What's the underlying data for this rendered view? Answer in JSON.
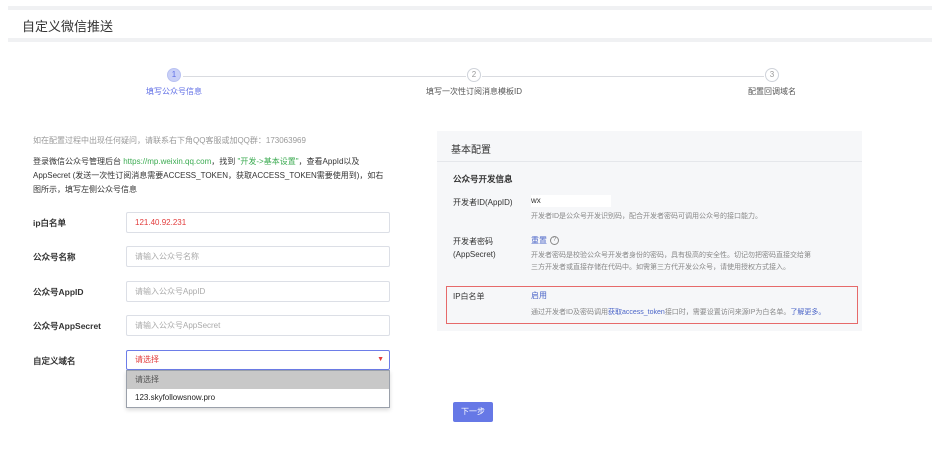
{
  "page": {
    "title": "自定义微信推送"
  },
  "steps": [
    {
      "num": "1",
      "label": "填写公众号信息",
      "active": true
    },
    {
      "num": "2",
      "label": "填写一次性订阅消息模板ID",
      "active": false
    },
    {
      "num": "3",
      "label": "配置回调域名",
      "active": false
    }
  ],
  "intro": {
    "tip": "如在配置过程中出现任何疑问，请联系右下角QQ客服或加QQ群：173063969",
    "line1_prefix": "登录微信公众号管理后台 ",
    "line1_link": "https://mp.weixin.qq.com",
    "line1_mid": "，找到 ",
    "line1_highlight": "\"开发->基本设置\"",
    "line1_suffix": "，查看AppId以及",
    "line2": "AppSecret (发送一次性订阅消息需要ACCESS_TOKEN，获取ACCESS_TOKEN需要使用到)，如右",
    "line3": "图所示，填写左侧公众号信息"
  },
  "form": {
    "ip_label": "ip白名单",
    "ip_value": "121.40.92.231",
    "name_label": "公众号名称",
    "name_placeholder": "请输入公众号名称",
    "appid_label": "公众号AppID",
    "appid_placeholder": "请输入公众号AppID",
    "secret_label": "公众号AppSecret",
    "secret_placeholder": "请输入公众号AppSecret",
    "domain_label": "自定义域名",
    "domain_selected": "请选择",
    "domain_options": [
      "请选择",
      "123.skyfollowsnow.pro"
    ]
  },
  "next_button": "下一步",
  "panel": {
    "title": "基本配置",
    "section": "公众号开发信息",
    "appid_label": "开发者ID(AppID)",
    "appid_value": "wx",
    "appid_desc": "开发者ID是公众号开发识别码，配合开发者密码可调用公众号的接口能力。",
    "secret_label1": "开发者密码",
    "secret_label2": "(AppSecret)",
    "secret_reset": "重置",
    "secret_help": "?",
    "secret_desc1": "开发者密码是校验公众号开发者身份的密码，具有极高的安全性。切记勿把密码直接交给第",
    "secret_desc2": "三方开发者或直接存储在代码中。如需第三方代开发公众号，请使用授权方式接入。",
    "whitelist_label": "IP白名单",
    "whitelist_action": "启用",
    "whitelist_desc_prefix": "通过开发者ID及密码调用",
    "whitelist_desc_link": "获取access_token",
    "whitelist_desc_mid": "接口时，需要设置访问来源IP为白名单。",
    "whitelist_desc_more": "了解更多。"
  }
}
